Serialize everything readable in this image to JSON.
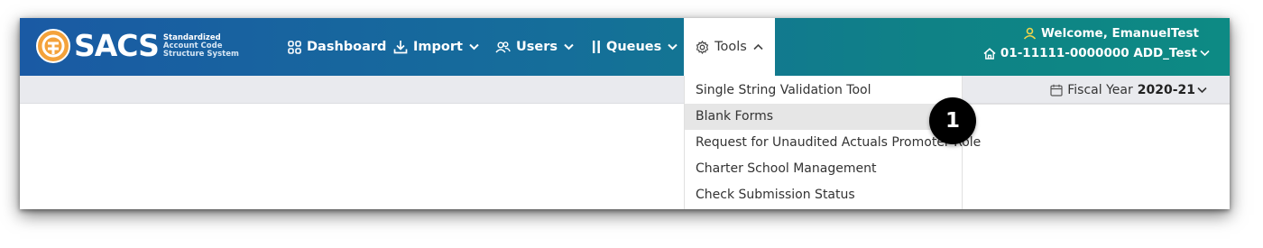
{
  "app": {
    "logo_word": "SACS",
    "logo_sub": [
      "Standardized",
      "Account Code",
      "Structure System"
    ]
  },
  "nav": {
    "dashboard": "Dashboard",
    "import": "Import",
    "users": "Users",
    "queues": "Queues",
    "tools": "Tools"
  },
  "user": {
    "welcome": "Welcome, EmanuelTest",
    "district": "01-11111-0000000 ADD_Test"
  },
  "fiscal": {
    "label": "Fiscal Year",
    "value": "2020-21"
  },
  "tools_menu": {
    "items": [
      "Single String Validation Tool",
      "Blank Forms",
      "Request for Unaudited Actuals Promoter Role",
      "Charter School Management",
      "Check Submission Status"
    ],
    "selected_index": 1
  },
  "callout": {
    "number": "1"
  },
  "colors": {
    "nav_start": "#1a5aa4",
    "nav_end": "#0d8a84",
    "user_icon": "#f2d54a",
    "logo_circle": "#f4a23b",
    "badge": "#000000"
  },
  "icons": [
    "sacs-logo-icon",
    "grid-icon",
    "download-icon",
    "users-icon",
    "queues-icon",
    "gear-icon",
    "chevron-down-icon",
    "chevron-up-icon",
    "user-icon",
    "home-icon",
    "calendar-icon"
  ]
}
